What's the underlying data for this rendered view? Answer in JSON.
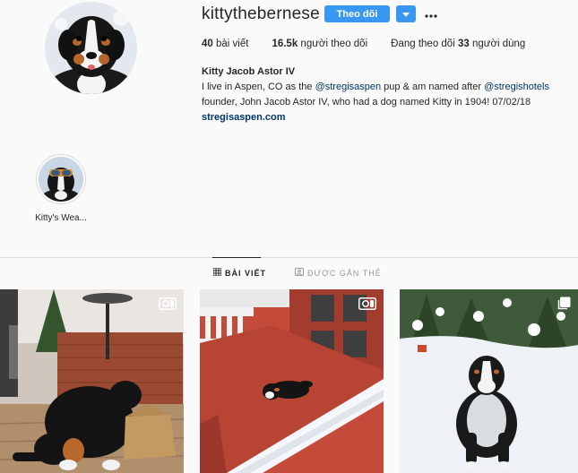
{
  "profile": {
    "username": "kittythebernese",
    "follow_label": "Theo dõi",
    "more_label": "•••",
    "stats": {
      "posts_count": "40",
      "posts_label": "bài viết",
      "followers_count": "16.5k",
      "followers_label": "người theo dõi",
      "following_prefix": "Đang theo dõi",
      "following_count": "33",
      "following_suffix": "người dùng"
    },
    "bio": {
      "full_name": "Kitty Jacob Astor IV",
      "text_1": "I live in Aspen, CO as the ",
      "mention_1": "@stregisaspen",
      "text_2": " pup & am named after ",
      "mention_2": "@stregishotels",
      "text_3": " founder, John Jacob Astor IV, who had a dog named Kitty in 1904! 07/02/18",
      "website": "stregisaspen.com"
    }
  },
  "highlights": [
    {
      "label": "Kitty's Wea..."
    }
  ],
  "tabs": {
    "posts": "BÀI VIẾT",
    "tagged": "ĐƯỢC GẮN THẺ"
  },
  "posts": [
    {
      "media_type": "video-icon"
    },
    {
      "media_type": "video-icon"
    },
    {
      "media_type": "carousel-icon"
    }
  ],
  "colors": {
    "accent": "#3897f0",
    "link": "#003569",
    "divider": "#dbdbdb",
    "background": "#fafafa"
  }
}
